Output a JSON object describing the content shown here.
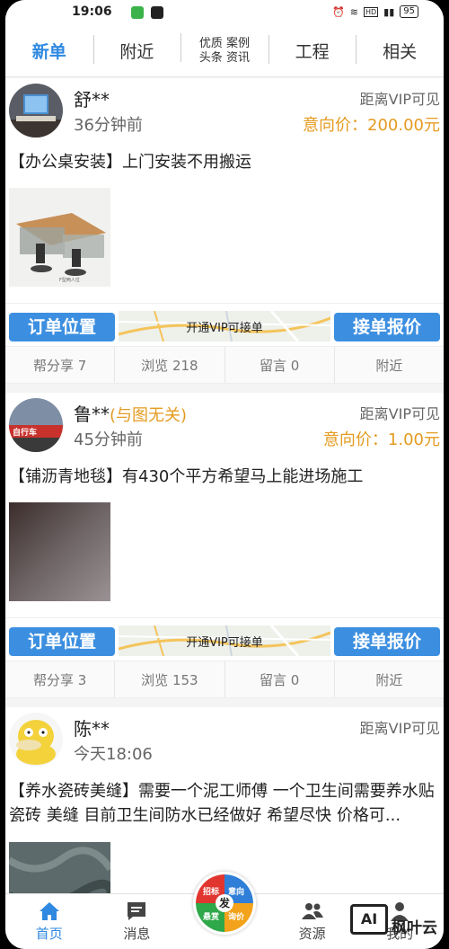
{
  "status_bar": {
    "time": "19:06",
    "battery": "95"
  },
  "tabs": [
    {
      "label": "新单",
      "active": true
    },
    {
      "label": "附近"
    },
    {
      "label_lines": [
        "优质 案例",
        "头条 资讯"
      ]
    },
    {
      "label": "工程"
    },
    {
      "label": "相关"
    }
  ],
  "posts": [
    {
      "name": "舒**",
      "tag": "",
      "time": "36分钟前",
      "distance": "距离VIP可见",
      "price": "意向价：200.00元",
      "title": "【办公桌安装】上门安装不用搬运",
      "pic_caption": "F型两人位",
      "order_btn": "订单位置",
      "map_label": "开通VIP可接单",
      "quote_btn": "接单报价",
      "stats": [
        "帮分享 7",
        "浏览 218",
        "留言 0",
        "附近"
      ]
    },
    {
      "name": "鲁**",
      "tag": "(与图无关)",
      "time": "45分钟前",
      "distance": "距离VIP可见",
      "price": "意向价：1.00元",
      "title": "【铺沥青地毯】有430个平方希望马上能进场施工",
      "avatar_text": "自行车",
      "order_btn": "订单位置",
      "map_label": "开通VIP可接单",
      "quote_btn": "接单报价",
      "stats": [
        "帮分享 3",
        "浏览 153",
        "留言 0",
        "附近"
      ]
    },
    {
      "name": "陈**",
      "tag": "",
      "time": "今天18:06",
      "distance": "距离VIP可见",
      "price": "",
      "title": "【养水瓷砖美缝】需要一个泥工师傅 一个卫生间需要养水贴瓷砖 美缝 目前卫生间防水已经做好 希望尽快 价格可..."
    }
  ],
  "fab": {
    "center": "发",
    "quadrants": [
      "招标",
      "意向",
      "悬赏",
      "询价"
    ]
  },
  "bottom_nav": [
    {
      "label": "首页",
      "icon": "home-icon",
      "active": true
    },
    {
      "label": "消息",
      "icon": "message-icon"
    },
    {
      "label": "",
      "icon": ""
    },
    {
      "label": "资源",
      "icon": "people-icon"
    },
    {
      "label": "我的",
      "icon": "user-icon"
    }
  ],
  "watermark": {
    "box": "AI",
    "text": "枫叶云"
  },
  "colors": {
    "accent": "#2f89e0",
    "price": "#e49b21",
    "button": "#3c8fe0"
  }
}
